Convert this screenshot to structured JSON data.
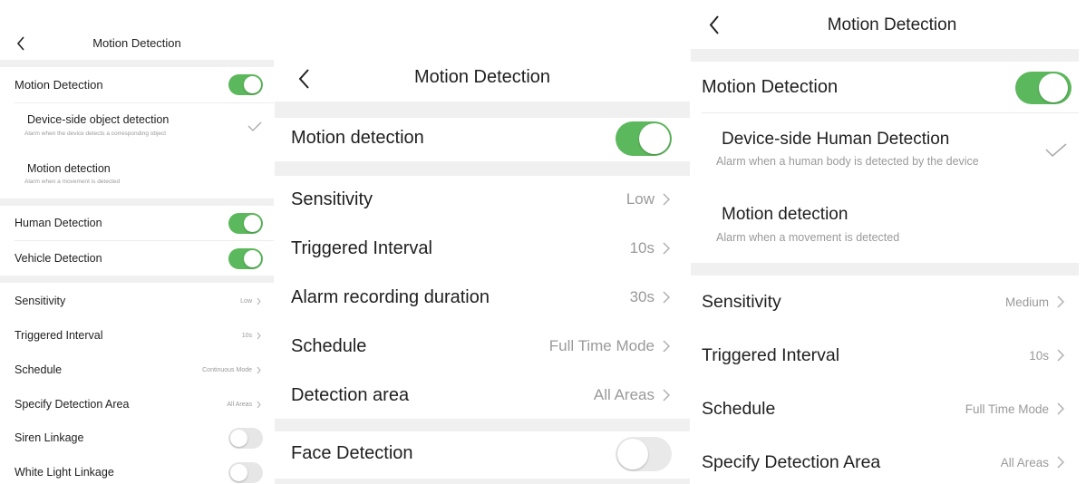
{
  "panel_left": {
    "title": "Motion Detection",
    "motion_detection": "Motion Detection",
    "device_side": {
      "title": "Device-side object detection",
      "subtitle": "Alarm when the device detects a corresponding object"
    },
    "motion_option": {
      "title": "Motion detection",
      "subtitle": "Alarm when a movement is detected"
    },
    "human_detection": "Human Detection",
    "vehicle_detection": "Vehicle Detection",
    "settings": [
      {
        "label": "Sensitivity",
        "value": "Low"
      },
      {
        "label": "Triggered Interval",
        "value": "10s"
      },
      {
        "label": "Schedule",
        "value": "Continuous Mode"
      },
      {
        "label": "Specify Detection Area",
        "value": "All Areas"
      }
    ],
    "siren_linkage": "Siren Linkage",
    "white_light_linkage": "White Light Linkage"
  },
  "panel_mid": {
    "title": "Motion Detection",
    "motion_detection": "Motion detection",
    "settings": [
      {
        "label": "Sensitivity",
        "value": "Low"
      },
      {
        "label": "Triggered Interval",
        "value": "10s"
      },
      {
        "label": "Alarm recording duration",
        "value": "30s"
      },
      {
        "label": "Schedule",
        "value": "Full Time Mode"
      },
      {
        "label": "Detection area",
        "value": "All Areas"
      }
    ],
    "face_detection": "Face Detection"
  },
  "panel_right": {
    "title": "Motion Detection",
    "motion_detection": "Motion Detection",
    "device_side": {
      "title": "Device-side Human Detection",
      "subtitle": "Alarm when a human body is detected by the device"
    },
    "motion_option": {
      "title": "Motion detection",
      "subtitle": "Alarm when a movement is detected"
    },
    "settings": [
      {
        "label": "Sensitivity",
        "value": "Medium"
      },
      {
        "label": "Triggered Interval",
        "value": "10s"
      },
      {
        "label": "Schedule",
        "value": "Full Time Mode"
      },
      {
        "label": "Specify Detection Area",
        "value": "All Areas"
      }
    ]
  },
  "icons": {
    "back": "chevron-left-icon",
    "row": "chevron-right-icon",
    "selected": "checkmark-icon"
  },
  "colors": {
    "toggle_on": "#5cb85c",
    "toggle_off": "#e6e6e6",
    "section_gap": "#f0f0f0"
  }
}
